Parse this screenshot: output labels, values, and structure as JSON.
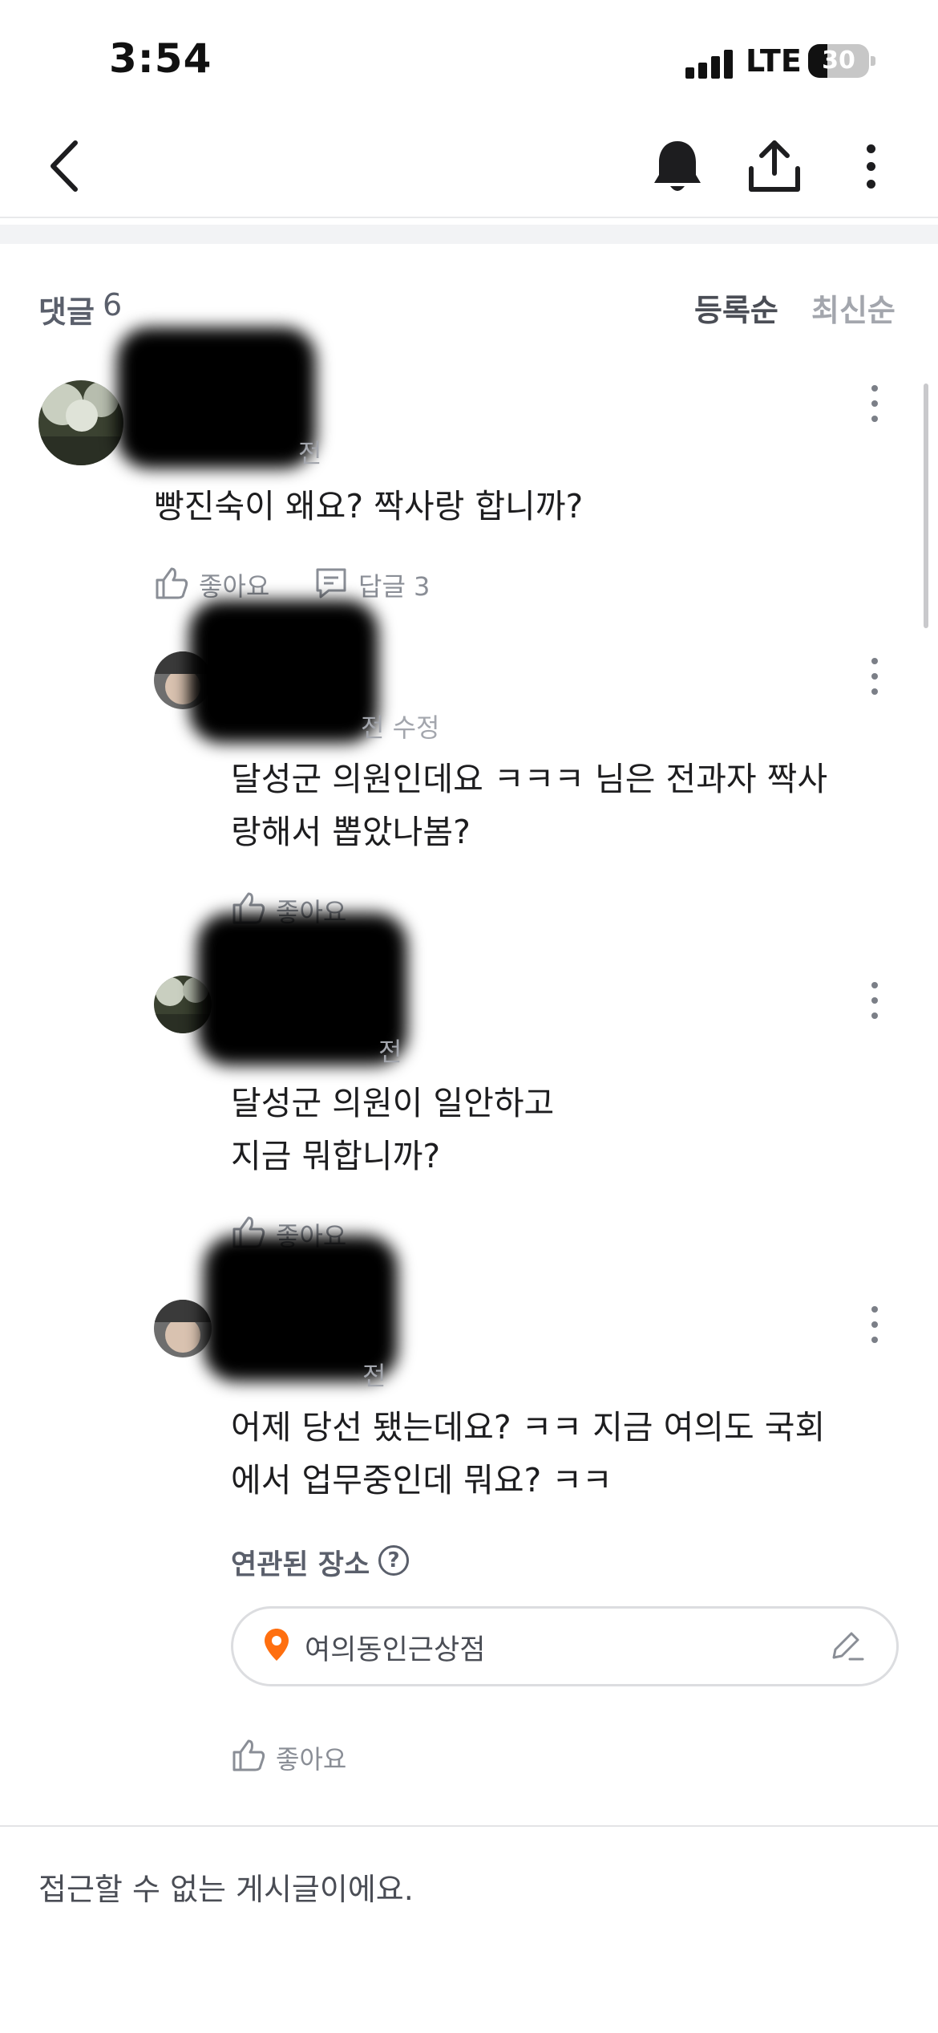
{
  "status_bar": {
    "time": "3:54",
    "network": "LTE",
    "battery": "30"
  },
  "comments": {
    "title": "댓글",
    "count": "6",
    "sort_options": [
      "등록순",
      "최신순"
    ],
    "active_sort": "등록순",
    "items": [
      {
        "time": "전",
        "text": "빵진숙이 왜요? 짝사랑 합니까?",
        "like_label": "좋아요",
        "reply_label": "답글 3"
      },
      {
        "time": "전 수정",
        "text_lines": [
          "달성군 의원인데요 ㅋㅋㅋ 님은 전과자 짝사",
          "랑해서 뽑았나봄?"
        ],
        "like_label": "좋아요"
      },
      {
        "time": "전",
        "text_lines": [
          "달성군 의원이 일안하고",
          "지금 뭐합니까?"
        ],
        "like_label": "좋아요"
      },
      {
        "time": "전",
        "text_lines": [
          "어제 당선 됐는데요? ㅋㅋ 지금 여의도 국회",
          "에서 업무중인데 뭐요? ㅋㅋ"
        ],
        "related_place_label": "연관된 장소",
        "place_name": "여의동인근상점",
        "like_label": "좋아요"
      }
    ]
  },
  "footer": {
    "notice": "접근할 수 없는 게시글이에요."
  },
  "colors": {
    "accent": "#ff6f0f",
    "text": "#1d1d1f",
    "muted": "#8a8e96"
  }
}
